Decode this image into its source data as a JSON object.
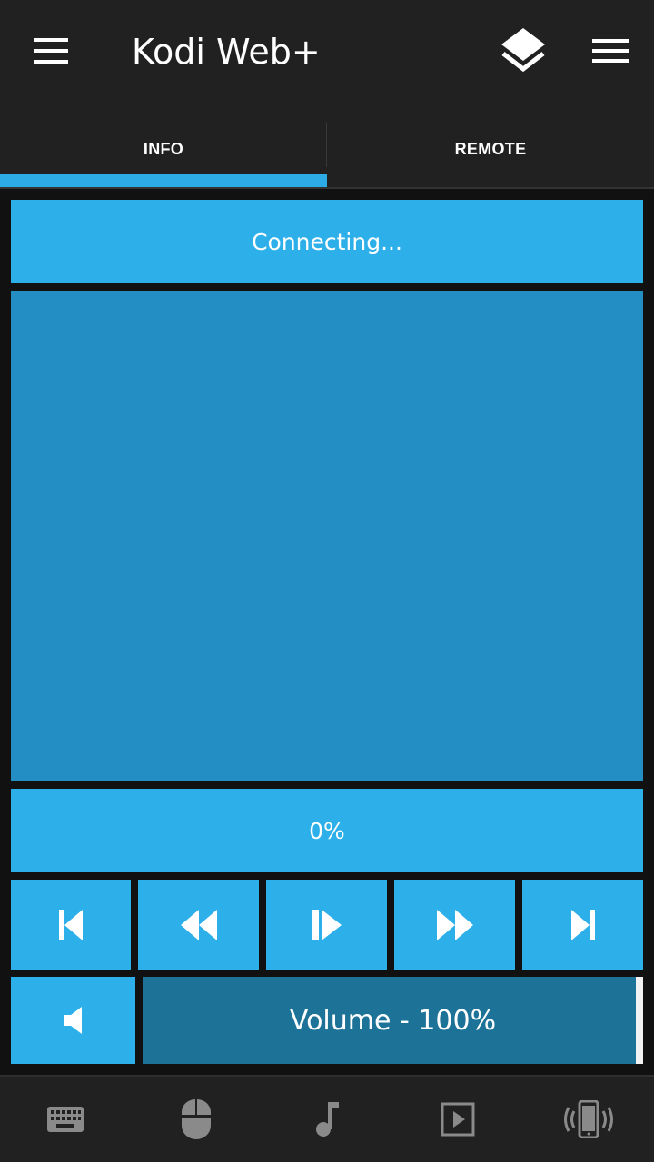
{
  "app": {
    "title": "Kodi Web+"
  },
  "tabs": [
    {
      "label": "INFO",
      "selected": true
    },
    {
      "label": "REMOTE",
      "selected": false
    }
  ],
  "status": {
    "text": "Connecting..."
  },
  "progress": {
    "label": "0%",
    "value": 0
  },
  "controls": {
    "icons": [
      "skip-previous-icon",
      "rewind-icon",
      "play-pause-icon",
      "fast-forward-icon",
      "skip-next-icon"
    ]
  },
  "volume": {
    "label": "Volume - 100%",
    "value": 100
  },
  "bottom_nav": {
    "icons": [
      "keyboard-icon",
      "mouse-icon",
      "music-note-icon",
      "video-play-icon",
      "phone-vibrate-icon"
    ]
  },
  "colors": {
    "accent": "#2dafe9",
    "art_background": "#238ec4",
    "volume_track": "#1d7298",
    "appbar": "#212121",
    "background": "#111111",
    "inactive_icon": "#8a8a8a"
  }
}
